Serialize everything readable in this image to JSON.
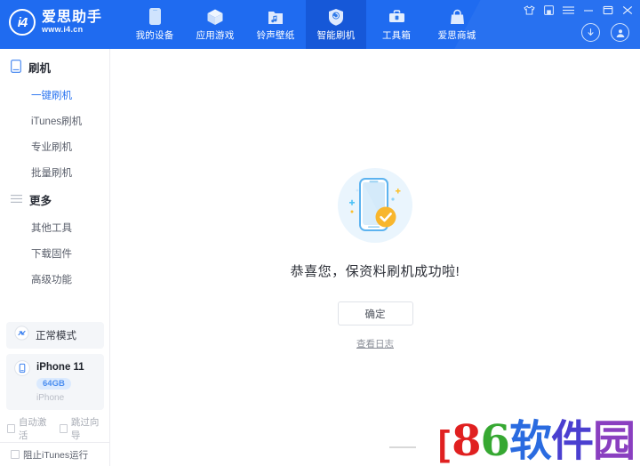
{
  "app": {
    "logo_mark": "i4",
    "logo_name": "爱思助手",
    "logo_url": "www.i4.cn"
  },
  "header": {
    "nav": [
      {
        "label": "我的设备",
        "icon": "phone-icon",
        "active": false
      },
      {
        "label": "应用游戏",
        "icon": "cube-icon",
        "active": false
      },
      {
        "label": "铃声壁纸",
        "icon": "music-folder-icon",
        "active": false
      },
      {
        "label": "智能刷机",
        "icon": "shield-refresh-icon",
        "active": true
      },
      {
        "label": "工具箱",
        "icon": "toolbox-icon",
        "active": false
      },
      {
        "label": "爱思商城",
        "icon": "shopping-bag-icon",
        "active": false
      }
    ],
    "window_controls": [
      {
        "name": "skin-icon",
        "glyph": "skin"
      },
      {
        "name": "save-icon",
        "glyph": "save"
      },
      {
        "name": "menu-icon",
        "glyph": "menu"
      },
      {
        "name": "minimize-icon",
        "glyph": "minimize"
      },
      {
        "name": "maximize-icon",
        "glyph": "maximize"
      },
      {
        "name": "close-icon",
        "glyph": "close"
      }
    ],
    "download_icon": "download-icon",
    "account_icon": "user-account-icon",
    "accent_color": "#1f6bf0",
    "active_tab_color": "#1658d8"
  },
  "sidebar": {
    "groups": [
      {
        "title": "刷机",
        "icon": "phone-outline-icon",
        "items": [
          {
            "label": "一键刷机",
            "active": true
          },
          {
            "label": "iTunes刷机",
            "active": false
          },
          {
            "label": "专业刷机",
            "active": false
          },
          {
            "label": "批量刷机",
            "active": false
          }
        ]
      },
      {
        "title": "更多",
        "icon": "list-icon",
        "items": [
          {
            "label": "其他工具",
            "active": false
          },
          {
            "label": "下载固件",
            "active": false
          },
          {
            "label": "高级功能",
            "active": false
          }
        ]
      }
    ],
    "mode": {
      "label": "正常模式",
      "icon": "mode-arrows-icon"
    },
    "device": {
      "name": "iPhone 11",
      "capacity": "64GB",
      "type": "iPhone",
      "icon": "device-phone-icon"
    },
    "options": [
      {
        "label": "自动激活",
        "checked": false
      },
      {
        "label": "跳过向导",
        "checked": false
      }
    ],
    "block_itunes": {
      "label": "阻止iTunes运行",
      "checked": false
    }
  },
  "main": {
    "illustration": "phone-success-illustration",
    "message": "恭喜您，保资料刷机成功啦!",
    "confirm_label": "确定",
    "log_link_label": "查看日志",
    "check_color": "#f8b62d",
    "phone_color": "#5cb3f0",
    "circle_color": "#eaf5fd"
  },
  "watermark": {
    "bracket": "[",
    "chars": [
      {
        "ch": "8",
        "color": "#e02020"
      },
      {
        "ch": "6",
        "color": "#36a832"
      },
      {
        "ch": "软",
        "color": "#2a6be0"
      },
      {
        "ch": "件",
        "color": "#4a3fd0"
      },
      {
        "ch": "园",
        "color": "#8a3fc0"
      }
    ]
  }
}
